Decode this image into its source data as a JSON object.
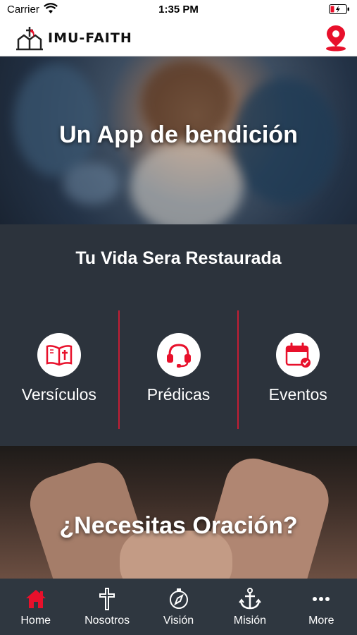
{
  "status_bar": {
    "carrier": "Carrier",
    "time": "1:35 PM"
  },
  "header": {
    "app_name": "IMU-FAITH"
  },
  "hero": {
    "title": "Un App de bendición"
  },
  "section": {
    "title": "Tu Vida Sera Restaurada",
    "features": [
      {
        "label": "Versículos",
        "icon": "bible-icon"
      },
      {
        "label": "Prédicas",
        "icon": "headset-icon"
      },
      {
        "label": "Eventos",
        "icon": "calendar-icon"
      }
    ]
  },
  "prayer": {
    "title": "¿Necesitas Oración?"
  },
  "tabs": [
    {
      "label": "Home",
      "icon": "home-icon",
      "active": true
    },
    {
      "label": "Nosotros",
      "icon": "cross-icon"
    },
    {
      "label": "Visión",
      "icon": "compass-icon"
    },
    {
      "label": "Misión",
      "icon": "anchor-icon"
    },
    {
      "label": "More",
      "icon": "more-icon"
    }
  ],
  "colors": {
    "accent": "#e8102b",
    "dark_bg": "#2c333c",
    "tabbar": "#2f3740"
  }
}
